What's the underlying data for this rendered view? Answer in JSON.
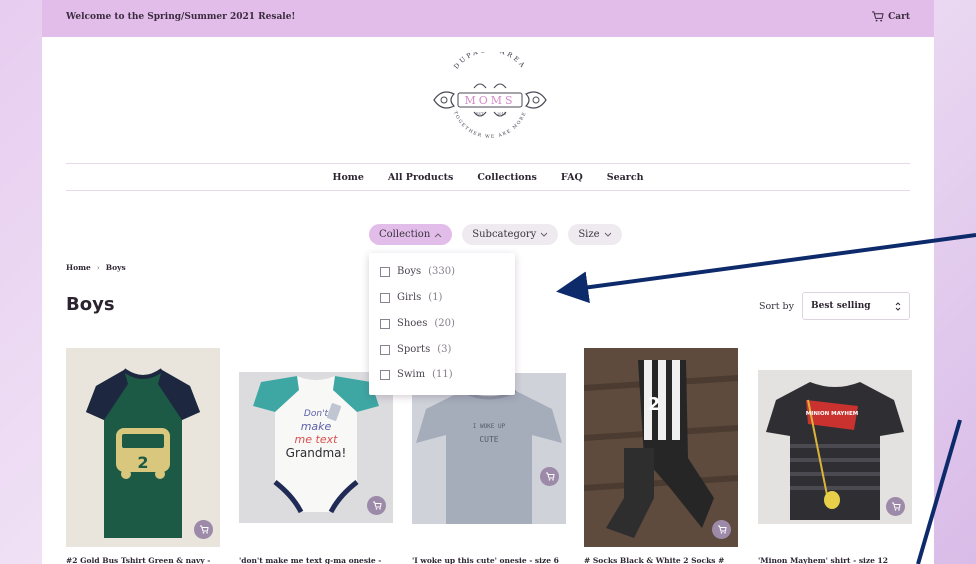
{
  "announcement": "Welcome to the Spring/Summer 2021 Resale!",
  "cart_label": "Cart",
  "logo": {
    "top_text": "DUPAGE AREA",
    "main_text": "MOMS",
    "est": "EST",
    "year": "2018",
    "bottom_text": "TOGETHER WE ARE MORE"
  },
  "nav": [
    "Home",
    "All Products",
    "Collections",
    "FAQ",
    "Search"
  ],
  "filters": [
    {
      "label": "Collection",
      "chevron": "^",
      "active": true
    },
    {
      "label": "Subcategory",
      "chevron": "v",
      "active": false
    },
    {
      "label": "Size",
      "chevron": "v",
      "active": false
    }
  ],
  "dropdown_items": [
    {
      "label": "Boys",
      "count": "(330)"
    },
    {
      "label": "Girls",
      "count": "(1)"
    },
    {
      "label": "Shoes",
      "count": "(20)"
    },
    {
      "label": "Sports",
      "count": "(3)"
    },
    {
      "label": "Swim",
      "count": "(11)"
    }
  ],
  "breadcrumb": {
    "home": "Home",
    "separator": "›",
    "current": "Boys"
  },
  "page_title": "Boys",
  "sort": {
    "label": "Sort by",
    "value": "Best selling"
  },
  "products": [
    {
      "name": "#2 Gold Bus Tshirt Green & navy -",
      "image_text": "2",
      "icon": "cart-icon"
    },
    {
      "name": "'don't make me text g-ma onesie -",
      "image_text": "Don't make me text Grandma!",
      "icon": "cart-icon"
    },
    {
      "name": "'I woke up this cute' onesie - size 6",
      "image_text": "I WOKE UP CUTE",
      "icon": "cart-icon"
    },
    {
      "name": "# Socks Black & White 2 Socks #",
      "image_text": "2",
      "icon": "cart-icon"
    },
    {
      "name": "'Minon Mayhem' shirt - size 12",
      "image_text": "MINION MAYHEM",
      "icon": "cart-icon"
    }
  ],
  "colors": {
    "topbar": "#e3bde9",
    "active_chip": "#e3bde9",
    "quick_add": "#9d8aa8",
    "arrow": "#0d2a6b"
  }
}
